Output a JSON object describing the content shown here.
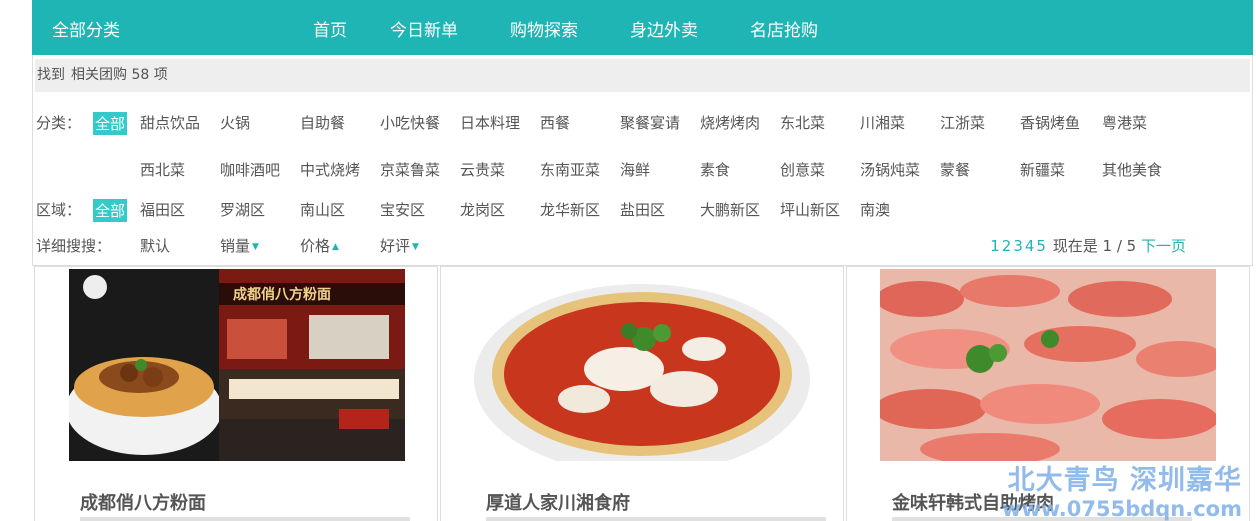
{
  "nav": {
    "category_label": "全部分类",
    "links": [
      "首页",
      "今日新单",
      "购物探索",
      "身边外卖",
      "名店抢购"
    ]
  },
  "found": {
    "prefix": "找到",
    "text": "相关团购 58 项"
  },
  "category": {
    "label": "分类：",
    "row1": [
      "全部",
      "甜点饮品",
      "火锅",
      "自助餐",
      "小吃快餐",
      "日本料理",
      "西餐",
      "聚餐宴请",
      "烧烤烤肉",
      "东北菜",
      "川湘菜",
      "江浙菜",
      "香锅烤鱼",
      "粤港菜"
    ],
    "row2": [
      "西北菜",
      "咖啡酒吧",
      "中式烧烤",
      "京菜鲁菜",
      "云贵菜",
      "东南亚菜",
      "海鲜",
      "素食",
      "创意菜",
      "汤锅炖菜",
      "蒙餐",
      "新疆菜",
      "其他美食"
    ]
  },
  "region": {
    "label": "区域：",
    "items": [
      "全部",
      "福田区",
      "罗湖区",
      "南山区",
      "宝安区",
      "龙岗区",
      "龙华新区",
      "盐田区",
      "大鹏新区",
      "坪山新区",
      "南澳"
    ]
  },
  "sort": {
    "label": "详细搜搜：",
    "items": [
      "默认",
      "销量",
      "价格",
      "好评"
    ],
    "arrows": [
      "",
      "▼",
      "▲",
      "▼"
    ]
  },
  "pager": {
    "pages": [
      "1",
      "2",
      "3",
      "4",
      "5"
    ],
    "status": "现在是 1 / 5",
    "next": "下一页"
  },
  "cards": [
    {
      "title": "成都俏八方粉面",
      "sign_text": "成都俏八方粉面"
    },
    {
      "title": "厚道人家川湘食府"
    },
    {
      "title": "金味轩韩式自助烤肉"
    }
  ],
  "watermark": {
    "line1": "北大青鸟 深圳嘉华",
    "line2": "www.0755bdqn.com"
  },
  "colors": {
    "accent": "#1fb5b5",
    "active_bg": "#36c9c9"
  }
}
